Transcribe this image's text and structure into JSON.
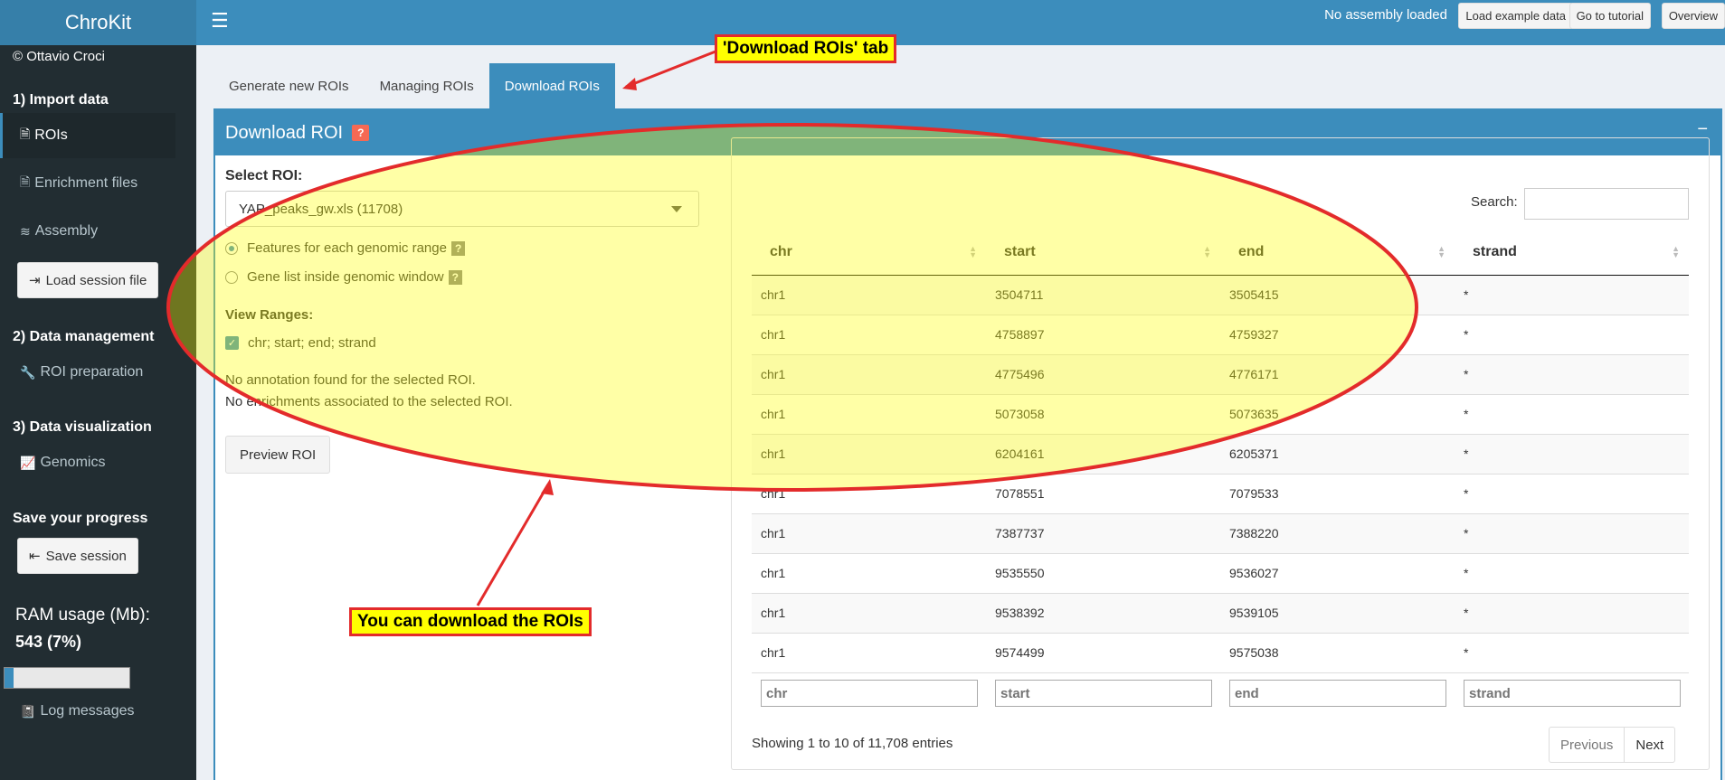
{
  "app": {
    "title": "ChroKit"
  },
  "navbar": {
    "menu_icon": "hamburger-icon",
    "status": "No assembly loaded",
    "buttons": [
      "Load example data",
      "Go to tutorial",
      "Overview"
    ]
  },
  "sidebar": {
    "copyright": "© Ottavio Croci",
    "section1": "1) Import data",
    "items_import": [
      {
        "label": "ROIs",
        "icon": "file-icon",
        "active": true
      },
      {
        "label": "Enrichment files",
        "icon": "file-icon"
      },
      {
        "label": "Assembly",
        "icon": "database-icon"
      }
    ],
    "load_session": "Load session file",
    "section2": "2) Data management",
    "roi_prep": "ROI preparation",
    "section3": "3) Data visualization",
    "genomics": "Genomics",
    "save_header": "Save your progress",
    "save_session": "Save session",
    "ram_label": "RAM usage (Mb):",
    "ram_value": "543 (7%)",
    "ram_fraction": 0.07,
    "log_messages": "Log messages"
  },
  "tabs": [
    {
      "label": "Generate new ROIs",
      "active": false
    },
    {
      "label": "Managing ROIs",
      "active": false
    },
    {
      "label": "Download ROIs",
      "active": true
    }
  ],
  "box": {
    "title": "Download ROI",
    "help": "?",
    "collapse": "−"
  },
  "form": {
    "select_label": "Select ROI:",
    "select_value": "YAP_peaks_gw.xls (11708)",
    "radio1": "Features for each genomic range",
    "radio2": "Gene list inside genomic window",
    "qmark": "?",
    "view_ranges_label": "View Ranges:",
    "view_ranges_value": "chr; start; end; strand",
    "msg1": "No annotation found for the selected ROI.",
    "msg2": "No enrichments associated to the selected ROI.",
    "preview_button": "Preview ROI"
  },
  "table": {
    "search_label": "Search:",
    "columns": [
      "chr",
      "start",
      "end",
      "strand"
    ],
    "rows": [
      [
        "chr1",
        "3504711",
        "3505415",
        "*"
      ],
      [
        "chr1",
        "4758897",
        "4759327",
        "*"
      ],
      [
        "chr1",
        "4775496",
        "4776171",
        "*"
      ],
      [
        "chr1",
        "5073058",
        "5073635",
        "*"
      ],
      [
        "chr1",
        "6204161",
        "6205371",
        "*"
      ],
      [
        "chr1",
        "7078551",
        "7079533",
        "*"
      ],
      [
        "chr1",
        "7387737",
        "7388220",
        "*"
      ],
      [
        "chr1",
        "9535550",
        "9536027",
        "*"
      ],
      [
        "chr1",
        "9538392",
        "9539105",
        "*"
      ],
      [
        "chr1",
        "9574499",
        "9575038",
        "*"
      ]
    ],
    "filters": [
      "chr",
      "start",
      "end",
      "strand"
    ],
    "info": "Showing 1 to 10 of 11,708 entries",
    "prev": "Previous",
    "next": "Next"
  },
  "annotations": {
    "tab_callout": "'Download ROIs' tab",
    "download_callout": "You can download the ROIs",
    "highlight_color": "#ffff80",
    "border_color": "#e32b2b"
  }
}
